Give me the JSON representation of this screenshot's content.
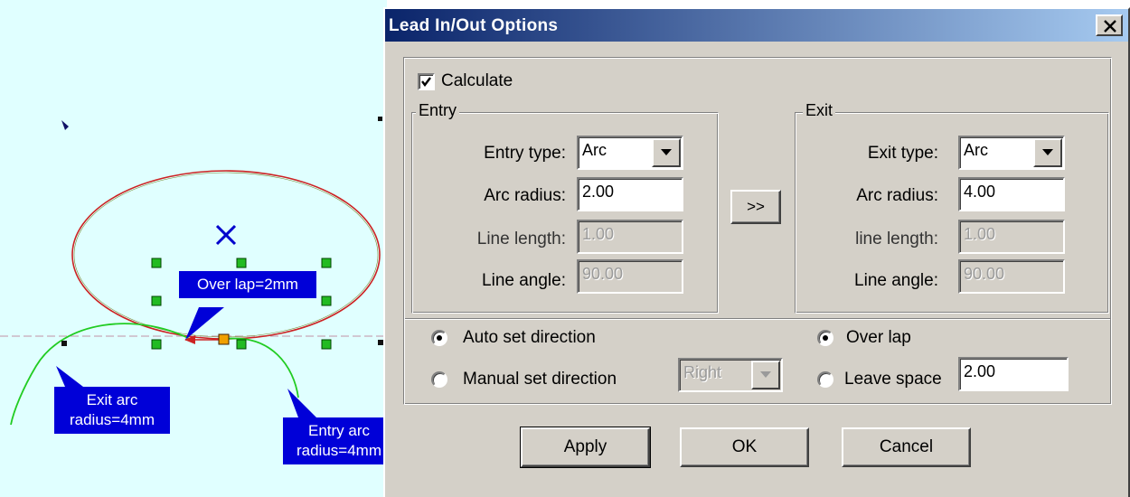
{
  "canvas": {
    "callouts": {
      "overlap": "Over lap=2mm",
      "exit_arc": "Exit arc\nradius=4mm",
      "entry_arc": "Entry arc\nradius=4mm"
    },
    "colors": {
      "background": "#e0ffff",
      "contour": "#cc2222",
      "lead_arc": "#22cc22",
      "handle": "#22bb22",
      "start_point": "#f0a000",
      "center_mark": "#0000cc",
      "callout": "#0000d8"
    }
  },
  "dialog": {
    "title": "Lead In/Out Options",
    "close_icon": "close-x-icon",
    "calculate": {
      "label": "Calculate",
      "checked": true
    },
    "entry": {
      "legend": "Entry",
      "type_label": "Entry type:",
      "type_value": "Arc",
      "arc_radius_label": "Arc radius:",
      "arc_radius_value": "2.00",
      "line_length_label": "Line length:",
      "line_length_value": "1.00",
      "line_angle_label": "Line angle:",
      "line_angle_value": "90.00"
    },
    "copy_button": ">>",
    "exit": {
      "legend": "Exit",
      "type_label": "Exit type:",
      "type_value": "Arc",
      "arc_radius_label": "Arc radius:",
      "arc_radius_value": "4.00",
      "line_length_label": "line length:",
      "line_length_value": "1.00",
      "line_angle_label": "Line angle:",
      "line_angle_value": "90.00"
    },
    "direction": {
      "auto_label": "Auto set direction",
      "manual_label": "Manual set direction",
      "selected": "auto",
      "manual_value": "Right"
    },
    "overlap": {
      "over_lap_label": "Over lap",
      "leave_space_label": "Leave space",
      "selected": "over_lap",
      "leave_space_value": "2.00"
    },
    "buttons": {
      "apply": "Apply",
      "ok": "OK",
      "cancel": "Cancel"
    }
  }
}
